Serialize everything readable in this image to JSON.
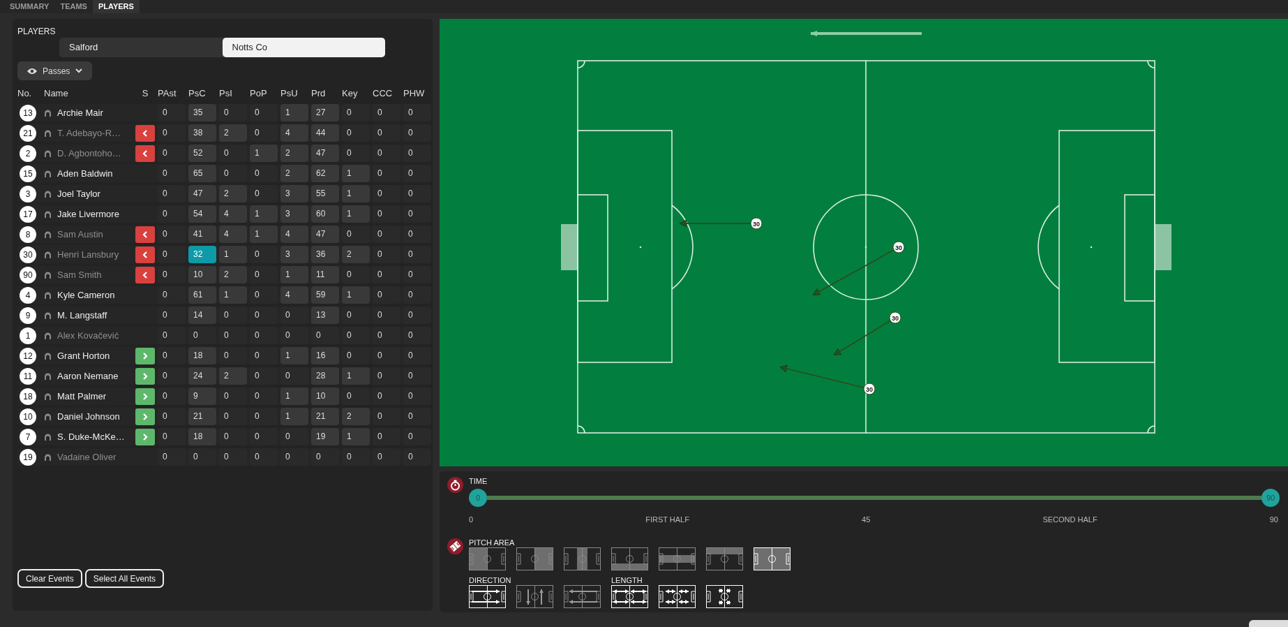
{
  "tabs": [
    {
      "label": "SUMMARY",
      "selected": false
    },
    {
      "label": "TEAMS",
      "selected": false
    },
    {
      "label": "PLAYERS",
      "selected": true
    }
  ],
  "players_panel": {
    "title": "PLAYERS",
    "teams": [
      {
        "label": "Salford",
        "selected": false
      },
      {
        "label": "Notts Co",
        "selected": true
      }
    ],
    "filter": {
      "label": "Passes"
    },
    "columns": [
      "No.",
      "Name",
      "S",
      "PAst",
      "PsC",
      "PsI",
      "PoP",
      "PsU",
      "Prd",
      "Key",
      "CCC",
      "PHW"
    ],
    "rows": [
      {
        "number": "13",
        "name": "Archie Mair",
        "dimmed": false,
        "subbed_off": false,
        "subbed_on": false,
        "stats": [
          "0",
          "35",
          "0",
          "0",
          "1",
          "27",
          "0",
          "0",
          "0"
        ],
        "active": [
          false,
          true,
          false,
          false,
          true,
          true,
          false,
          false,
          false
        ],
        "selected": [
          false,
          false,
          false,
          false,
          false,
          false,
          false,
          false,
          false
        ]
      },
      {
        "number": "21",
        "name": "T. Adebayo-R…",
        "dimmed": true,
        "subbed_off": true,
        "subbed_on": false,
        "stats": [
          "0",
          "38",
          "2",
          "0",
          "4",
          "44",
          "0",
          "0",
          "0"
        ],
        "active": [
          false,
          true,
          true,
          false,
          true,
          true,
          false,
          false,
          false
        ],
        "selected": [
          false,
          false,
          false,
          false,
          false,
          false,
          false,
          false,
          false
        ]
      },
      {
        "number": "2",
        "name": "D. Agbontoho…",
        "dimmed": true,
        "subbed_off": true,
        "subbed_on": false,
        "stats": [
          "0",
          "52",
          "0",
          "1",
          "2",
          "47",
          "0",
          "0",
          "0"
        ],
        "active": [
          false,
          true,
          false,
          true,
          true,
          true,
          false,
          false,
          false
        ],
        "selected": [
          false,
          false,
          false,
          false,
          false,
          false,
          false,
          false,
          false
        ]
      },
      {
        "number": "15",
        "name": "Aden Baldwin",
        "dimmed": false,
        "subbed_off": false,
        "subbed_on": false,
        "stats": [
          "0",
          "65",
          "0",
          "0",
          "2",
          "62",
          "1",
          "0",
          "0"
        ],
        "active": [
          false,
          true,
          false,
          false,
          true,
          true,
          true,
          false,
          false
        ],
        "selected": [
          false,
          false,
          false,
          false,
          false,
          false,
          false,
          false,
          false
        ]
      },
      {
        "number": "3",
        "name": "Joel Taylor",
        "dimmed": false,
        "subbed_off": false,
        "subbed_on": false,
        "stats": [
          "0",
          "47",
          "2",
          "0",
          "3",
          "55",
          "1",
          "0",
          "0"
        ],
        "active": [
          false,
          true,
          true,
          false,
          true,
          true,
          true,
          false,
          false
        ],
        "selected": [
          false,
          false,
          false,
          false,
          false,
          false,
          false,
          false,
          false
        ]
      },
      {
        "number": "17",
        "name": "Jake Livermore",
        "dimmed": false,
        "subbed_off": false,
        "subbed_on": false,
        "stats": [
          "0",
          "54",
          "4",
          "1",
          "3",
          "60",
          "1",
          "0",
          "0"
        ],
        "active": [
          false,
          true,
          true,
          true,
          true,
          true,
          true,
          false,
          false
        ],
        "selected": [
          false,
          false,
          false,
          false,
          false,
          false,
          false,
          false,
          false
        ]
      },
      {
        "number": "8",
        "name": "Sam Austin",
        "dimmed": true,
        "subbed_off": true,
        "subbed_on": false,
        "stats": [
          "0",
          "41",
          "4",
          "1",
          "4",
          "47",
          "0",
          "0",
          "0"
        ],
        "active": [
          false,
          true,
          true,
          true,
          true,
          true,
          false,
          false,
          false
        ],
        "selected": [
          false,
          false,
          false,
          false,
          false,
          false,
          false,
          false,
          false
        ]
      },
      {
        "number": "30",
        "name": "Henri Lansbury",
        "dimmed": true,
        "subbed_off": true,
        "subbed_on": false,
        "stats": [
          "0",
          "32",
          "1",
          "0",
          "3",
          "36",
          "2",
          "0",
          "0"
        ],
        "active": [
          false,
          true,
          true,
          false,
          true,
          true,
          true,
          false,
          false
        ],
        "selected": [
          false,
          true,
          false,
          false,
          false,
          false,
          false,
          false,
          false
        ]
      },
      {
        "number": "90",
        "name": "Sam Smith",
        "dimmed": true,
        "subbed_off": true,
        "subbed_on": false,
        "stats": [
          "0",
          "10",
          "2",
          "0",
          "1",
          "11",
          "0",
          "0",
          "0"
        ],
        "active": [
          false,
          true,
          true,
          false,
          true,
          true,
          false,
          false,
          false
        ],
        "selected": [
          false,
          false,
          false,
          false,
          false,
          false,
          false,
          false,
          false
        ]
      },
      {
        "number": "4",
        "name": "Kyle Cameron",
        "dimmed": false,
        "subbed_off": false,
        "subbed_on": false,
        "stats": [
          "0",
          "61",
          "1",
          "0",
          "4",
          "59",
          "1",
          "0",
          "0"
        ],
        "active": [
          false,
          true,
          true,
          false,
          true,
          true,
          true,
          false,
          false
        ],
        "selected": [
          false,
          false,
          false,
          false,
          false,
          false,
          false,
          false,
          false
        ]
      },
      {
        "number": "9",
        "name": "M. Langstaff",
        "dimmed": false,
        "subbed_off": false,
        "subbed_on": false,
        "stats": [
          "0",
          "14",
          "0",
          "0",
          "0",
          "13",
          "0",
          "0",
          "0"
        ],
        "active": [
          false,
          true,
          false,
          false,
          false,
          true,
          false,
          false,
          false
        ],
        "selected": [
          false,
          false,
          false,
          false,
          false,
          false,
          false,
          false,
          false
        ]
      },
      {
        "number": "1",
        "name": "Alex Kovačević",
        "dimmed": true,
        "subbed_off": false,
        "subbed_on": false,
        "stats": [
          "0",
          "0",
          "0",
          "0",
          "0",
          "0",
          "0",
          "0",
          "0"
        ],
        "active": [
          false,
          false,
          false,
          false,
          false,
          false,
          false,
          false,
          false
        ],
        "selected": [
          false,
          false,
          false,
          false,
          false,
          false,
          false,
          false,
          false
        ]
      },
      {
        "number": "12",
        "name": "Grant Horton",
        "dimmed": false,
        "subbed_off": false,
        "subbed_on": true,
        "stats": [
          "0",
          "18",
          "0",
          "0",
          "1",
          "16",
          "0",
          "0",
          "0"
        ],
        "active": [
          false,
          true,
          false,
          false,
          true,
          true,
          false,
          false,
          false
        ],
        "selected": [
          false,
          false,
          false,
          false,
          false,
          false,
          false,
          false,
          false
        ]
      },
      {
        "number": "11",
        "name": "Aaron Nemane",
        "dimmed": false,
        "subbed_off": false,
        "subbed_on": true,
        "stats": [
          "0",
          "24",
          "2",
          "0",
          "0",
          "28",
          "1",
          "0",
          "0"
        ],
        "active": [
          false,
          true,
          true,
          false,
          false,
          true,
          true,
          false,
          false
        ],
        "selected": [
          false,
          false,
          false,
          false,
          false,
          false,
          false,
          false,
          false
        ]
      },
      {
        "number": "18",
        "name": "Matt Palmer",
        "dimmed": false,
        "subbed_off": false,
        "subbed_on": true,
        "stats": [
          "0",
          "9",
          "0",
          "0",
          "1",
          "10",
          "0",
          "0",
          "0"
        ],
        "active": [
          false,
          true,
          false,
          false,
          true,
          true,
          false,
          false,
          false
        ],
        "selected": [
          false,
          false,
          false,
          false,
          false,
          false,
          false,
          false,
          false
        ]
      },
      {
        "number": "10",
        "name": "Daniel Johnson",
        "dimmed": false,
        "subbed_off": false,
        "subbed_on": true,
        "stats": [
          "0",
          "21",
          "0",
          "0",
          "1",
          "21",
          "2",
          "0",
          "0"
        ],
        "active": [
          false,
          true,
          false,
          false,
          true,
          true,
          true,
          false,
          false
        ],
        "selected": [
          false,
          false,
          false,
          false,
          false,
          false,
          false,
          false,
          false
        ]
      },
      {
        "number": "7",
        "name": "S. Duke-McKe…",
        "dimmed": false,
        "subbed_off": false,
        "subbed_on": true,
        "stats": [
          "0",
          "18",
          "0",
          "0",
          "0",
          "19",
          "1",
          "0",
          "0"
        ],
        "active": [
          false,
          true,
          false,
          false,
          false,
          true,
          true,
          false,
          false
        ],
        "selected": [
          false,
          false,
          false,
          false,
          false,
          false,
          false,
          false,
          false
        ]
      },
      {
        "number": "19",
        "name": "Vadaine Oliver",
        "dimmed": true,
        "subbed_off": false,
        "subbed_on": false,
        "stats": [
          "0",
          "0",
          "0",
          "0",
          "0",
          "0",
          "0",
          "0",
          "0"
        ],
        "active": [
          false,
          false,
          false,
          false,
          false,
          false,
          false,
          false,
          false
        ],
        "selected": [
          false,
          false,
          false,
          false,
          false,
          false,
          false,
          false,
          false
        ]
      }
    ],
    "buttons": [
      "Clear Events",
      "Select All Events"
    ]
  },
  "pitch": {
    "passes": [
      {
        "player": "30"
      },
      {
        "player": "30"
      },
      {
        "player": "30"
      },
      {
        "player": "30"
      }
    ]
  },
  "time": {
    "label": "TIME",
    "thumbs": [
      {
        "label": "0"
      },
      {
        "label": "90"
      }
    ],
    "ticks": [
      "0",
      "FIRST HALF",
      "45",
      "SECOND HALF",
      "90"
    ]
  },
  "pitch_area": {
    "label": "PITCH AREA",
    "options": [
      {
        "kind": "left",
        "selected": false
      },
      {
        "kind": "right",
        "selected": false
      },
      {
        "kind": "centre",
        "selected": false
      },
      {
        "kind": "bottom",
        "selected": false
      },
      {
        "kind": "middle",
        "selected": false
      },
      {
        "kind": "top",
        "selected": false
      },
      {
        "kind": "all",
        "selected": true
      }
    ]
  },
  "direction": {
    "label": "DIRECTION",
    "options": [
      {
        "kind": "forward",
        "selected": true
      },
      {
        "kind": "sideways",
        "selected": false
      },
      {
        "kind": "backward",
        "selected": false
      }
    ]
  },
  "length": {
    "label": "LENGTH",
    "options": [
      {
        "kind": "long",
        "selected": true
      },
      {
        "kind": "medium",
        "selected": true
      },
      {
        "kind": "short",
        "selected": true
      }
    ]
  }
}
